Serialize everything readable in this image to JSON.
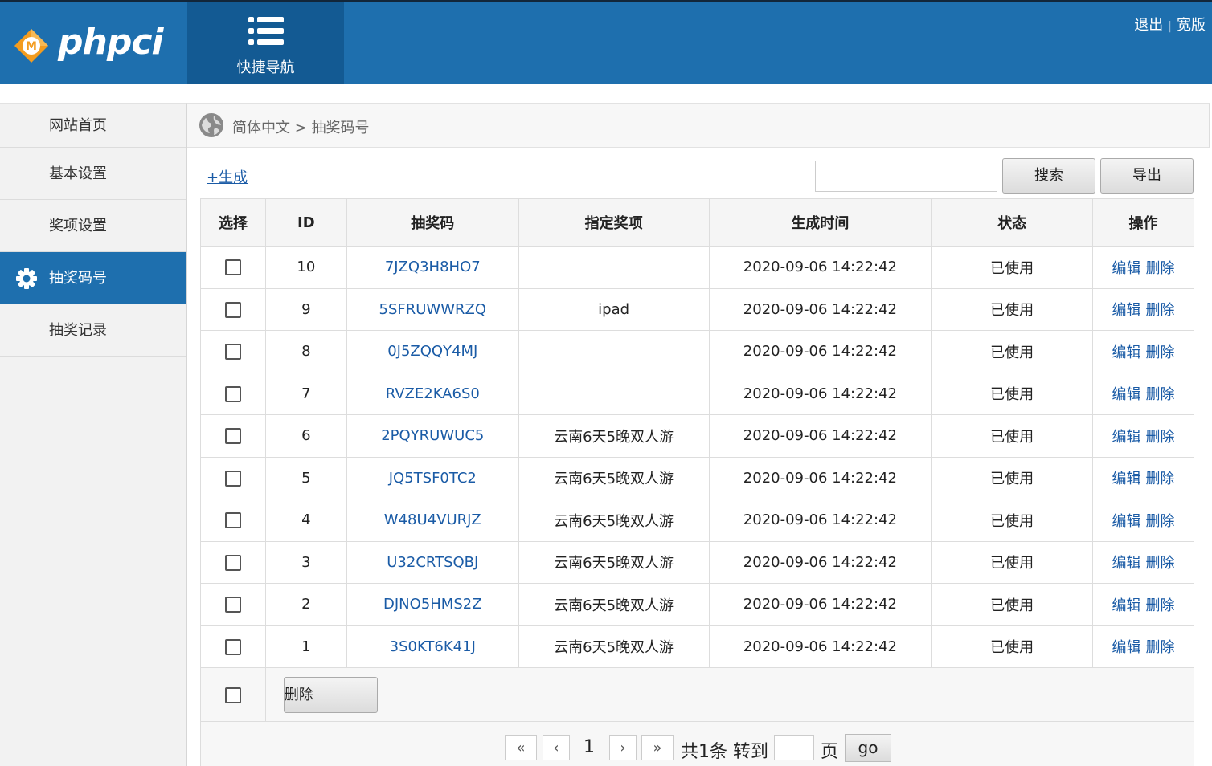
{
  "header": {
    "logo_text": "phpci",
    "logo_badge": "M",
    "quicknav_label": "快捷导航",
    "links": [
      "退出",
      "宽版"
    ],
    "colors": {
      "bar": "#1e6fae",
      "quicknav": "#135a93",
      "logo_orange": "#f39c1f"
    }
  },
  "sidebar": {
    "items": [
      {
        "label": "网站首页"
      },
      {
        "label": "基本设置"
      },
      {
        "label": "奖项设置"
      },
      {
        "label": "抽奖码号",
        "active": true,
        "icon": "gear-icon"
      },
      {
        "label": "抽奖记录"
      }
    ]
  },
  "breadcrumb": {
    "icon": "globe-icon",
    "text": "简体中文 > 抽奖码号"
  },
  "toolbar": {
    "generate_label": "+生成",
    "search_value": "",
    "search_label": "搜索",
    "export_label": "导出"
  },
  "table": {
    "headers": [
      "选择",
      "ID",
      "抽奖码",
      "指定奖项",
      "生成时间",
      "状态",
      "操作"
    ],
    "rows": [
      {
        "id": "10",
        "code": "7JZQ3H8HO7",
        "prize": "",
        "time": "2020-09-06 14:22:42",
        "status": "已使用"
      },
      {
        "id": "9",
        "code": "5SFRUWWRZQ",
        "prize": "ipad",
        "time": "2020-09-06 14:22:42",
        "status": "已使用"
      },
      {
        "id": "8",
        "code": "0J5ZQQY4MJ",
        "prize": "",
        "time": "2020-09-06 14:22:42",
        "status": "已使用"
      },
      {
        "id": "7",
        "code": "RVZE2KA6S0",
        "prize": "",
        "time": "2020-09-06 14:22:42",
        "status": "已使用"
      },
      {
        "id": "6",
        "code": "2PQYRUWUC5",
        "prize": "云南6天5晚双人游",
        "time": "2020-09-06 14:22:42",
        "status": "已使用"
      },
      {
        "id": "5",
        "code": "JQ5TSF0TC2",
        "prize": "云南6天5晚双人游",
        "time": "2020-09-06 14:22:42",
        "status": "已使用"
      },
      {
        "id": "4",
        "code": "W48U4VURJZ",
        "prize": "云南6天5晚双人游",
        "time": "2020-09-06 14:22:42",
        "status": "已使用"
      },
      {
        "id": "3",
        "code": "U32CRTSQBJ",
        "prize": "云南6天5晚双人游",
        "time": "2020-09-06 14:22:42",
        "status": "已使用"
      },
      {
        "id": "2",
        "code": "DJNO5HMS2Z",
        "prize": "云南6天5晚双人游",
        "time": "2020-09-06 14:22:42",
        "status": "已使用"
      },
      {
        "id": "1",
        "code": "3S0KT6K41J",
        "prize": "云南6天5晚双人游",
        "time": "2020-09-06 14:22:42",
        "status": "已使用"
      }
    ],
    "edit_label": "编辑",
    "delete_label": "删除",
    "bulk_delete_label": "删除"
  },
  "pager": {
    "first": "«",
    "prev": "‹",
    "current": "1",
    "next": "›",
    "last": "»",
    "summary": "共1条 转到",
    "page_unit": "页",
    "go_label": "go",
    "goto_value": ""
  }
}
